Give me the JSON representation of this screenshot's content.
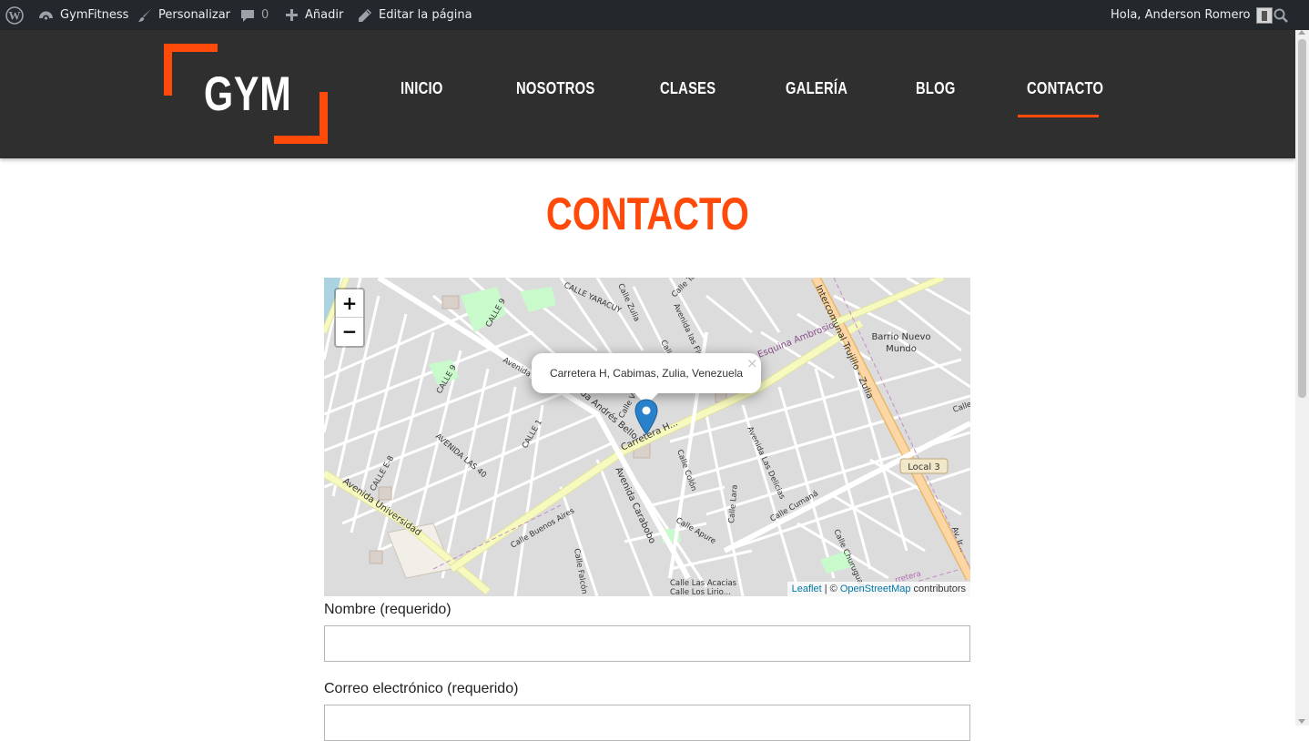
{
  "admin_bar": {
    "site_name": "GymFitness",
    "customize": "Personalizar",
    "comments_count": "0",
    "new_label": "Añadir",
    "edit_page": "Editar la página",
    "greeting": "Hola, Anderson Romero"
  },
  "header": {
    "logo_text": "GYM",
    "nav": [
      "INICIO",
      "NOSOTROS",
      "CLASES",
      "GALERÍA",
      "BLOG",
      "CONTACTO"
    ],
    "active": "CONTACTO",
    "accent_color": "#ff4a0a"
  },
  "page": {
    "title": "CONTACTO"
  },
  "map": {
    "zoom_in": "+",
    "zoom_out": "−",
    "popup_text": "Carretera H, Cabimas, Zulia, Venezuela",
    "popup_close": "×",
    "attribution": {
      "leaflet": "Leaflet",
      "separator": " | © ",
      "osm": "OpenStreetMap",
      "contributors": " contributors"
    },
    "labels": {
      "calle_yaracuy": "CALLE YARACUY",
      "calle_zulia": "Calle Zulia",
      "calle_taratare": "Calle Tarata...",
      "av_las_flores": "Avenida las Flor...",
      "calle_m": "Calle M. G...",
      "calle_9a": "CALLE 9",
      "calle_9b": "CALLE 9",
      "avenida_top": "Avenida",
      "avenida_andres": "Avenida Andrés Bello",
      "carretera_h": "Carretera H...",
      "calle_1": "CALLE 1",
      "av_las_40": "AVENIDA LAS 40",
      "calle_e8": "CALLE E-8",
      "av_universidad": "Avenida Universidad",
      "av_carabobo": "Avenida Carabobo",
      "calle_colon": "Calle Colón",
      "calle_lara": "Calle Lara",
      "av_las_delicias": "Avenida Las Delicias",
      "calle_apure": "Calle Apure",
      "calle_buenos_aires": "Calle Buenos Aires",
      "calle_falcon": "Calle Falcón",
      "calle_cumana": "Calle Cumaná",
      "calle_churuguara": "Calle Churuguara",
      "calle_las_acacias": "Calle Las Acacias",
      "calle_los_lirios": "Calle Los Lirio...",
      "intercomunal": "Intercomunal Trujillo - Zulia",
      "esquina_ambrosio": "Esquina Ambrosio",
      "barrio_line1": "Barrio Nuevo",
      "barrio_line2": "Mundo",
      "local3": "Local 3",
      "calle_right": "Calle",
      "av_right": "Av. Ir...",
      "carretera_bottom": "rretera",
      "calle_vi": "Calle Vi..."
    }
  },
  "form": {
    "name_label": "Nombre (requerido)",
    "email_label": "Correo electrónico (requerido)"
  }
}
